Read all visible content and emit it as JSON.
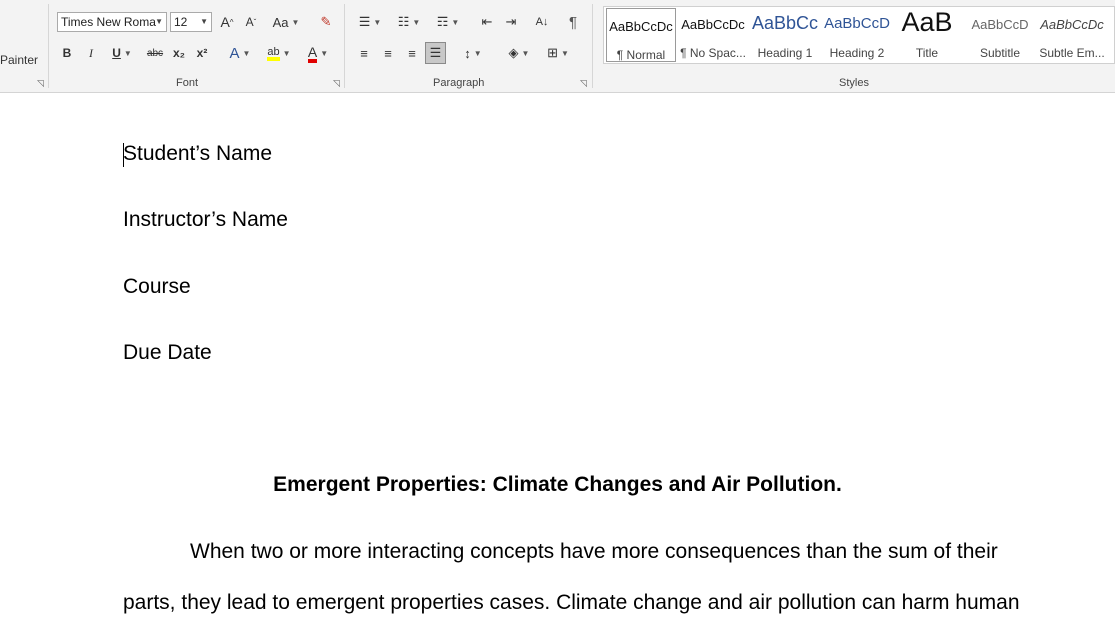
{
  "clipboard": {
    "format_painter_label": "Painter"
  },
  "font": {
    "group_label": "Font",
    "font_name": "Times New Roma",
    "font_size": "12",
    "grow_icon": "A",
    "shrink_icon": "A",
    "case_icon": "Aa",
    "bold": "B",
    "italic": "I",
    "underline": "U",
    "strike": "abc",
    "subscript": "x₂",
    "superscript": "x²",
    "effects_icon": "A",
    "highlight_icon": "ab",
    "color_icon": "A",
    "highlight_color": "#ffff00",
    "font_color": "#e00000"
  },
  "paragraph": {
    "group_label": "Paragraph",
    "sort_icon": "A↓",
    "pilcrow": "¶"
  },
  "styles": {
    "group_label": "Styles",
    "items": [
      {
        "preview": "AaBbCcDc",
        "name": "¶ Normal"
      },
      {
        "preview": "AaBbCcDc",
        "name": "¶ No Spac..."
      },
      {
        "preview": "AaBbCc",
        "name": "Heading 1"
      },
      {
        "preview": "AaBbCcD",
        "name": "Heading 2"
      },
      {
        "preview": "AaB",
        "name": "Title"
      },
      {
        "preview": "AaBbCcD",
        "name": "Subtitle"
      },
      {
        "preview": "AaBbCcDc",
        "name": "Subtle Em..."
      }
    ],
    "heading_color": "#2f5496"
  },
  "document": {
    "student_name": "Student’s Name",
    "instructor_name": "Instructor’s Name",
    "course": "Course",
    "due_date": "Due Date",
    "title": "Emergent Properties: Climate Changes and Air Pollution.",
    "para_line1": "When two or more interacting concepts have more consequences than the sum of their",
    "para_line2": "parts, they lead to emergent properties cases.  Climate change and air pollution can harm human"
  }
}
